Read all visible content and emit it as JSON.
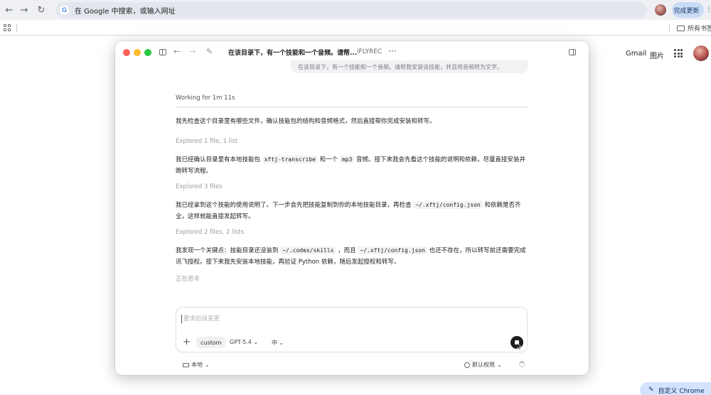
{
  "browser": {
    "omnibox_placeholder": "在 Google 中搜索，或输入网址",
    "update_button": "完成更新",
    "bookmarks_folder": "所有书签"
  },
  "google": {
    "gmail": "Gmail",
    "images": "图片",
    "customize": "自定义 Chrome"
  },
  "window": {
    "title": "在该目录下，有一个技能和一个音频。请帮...",
    "app_name": "iFLYREC",
    "more": "···",
    "user_message": "在该目录下，有一个技能和一个音频。请帮我安装该技能，并且将音频转为文字。"
  },
  "transcript": {
    "working": "Working for 1m 11s",
    "p1": "我先检查这个目录里有哪些文件，确认技能包的结构和音频格式，然后直接帮你完成安装和转写。",
    "meta1": "Explored 1 file, 1 list",
    "p2_a": "我已经确认目录里有本地技能包",
    "p2_code1": "xftj-transcribe",
    "p2_b": "和一个",
    "p2_code2": "mp3",
    "p2_c": "音频。接下来我会先看这个技能的说明和依赖，尽量直接安装并跑转写流程。",
    "meta2": "Explored 3 files",
    "p3_a": "我已经拿到这个技能的使用说明了。下一步会先把技能复制到你的本地技能目录，再检查",
    "p3_code1": "~/.xftj/config.json",
    "p3_b": "和依赖是否齐全，这样就能直接发起转写。",
    "meta3": "Explored 2 files, 2 lists",
    "p4_a": "我发现一个关键点：技能目录还没装到",
    "p4_code1": "~/.codex/skills",
    "p4_b": "，而且",
    "p4_code2": "~/.xftj/config.json",
    "p4_c": "也还不存在，所以转写前还需要完成讯飞授权。接下来我先安装本地技能，再验证 Python 依赖，随后发起授权和转写。",
    "thinking": "正在思考"
  },
  "composer": {
    "placeholder": "要求后续变更",
    "chip": "custom",
    "model": "GPT-5.4",
    "lang": "中"
  },
  "footer": {
    "local": "本地",
    "permission": "默认权限"
  }
}
